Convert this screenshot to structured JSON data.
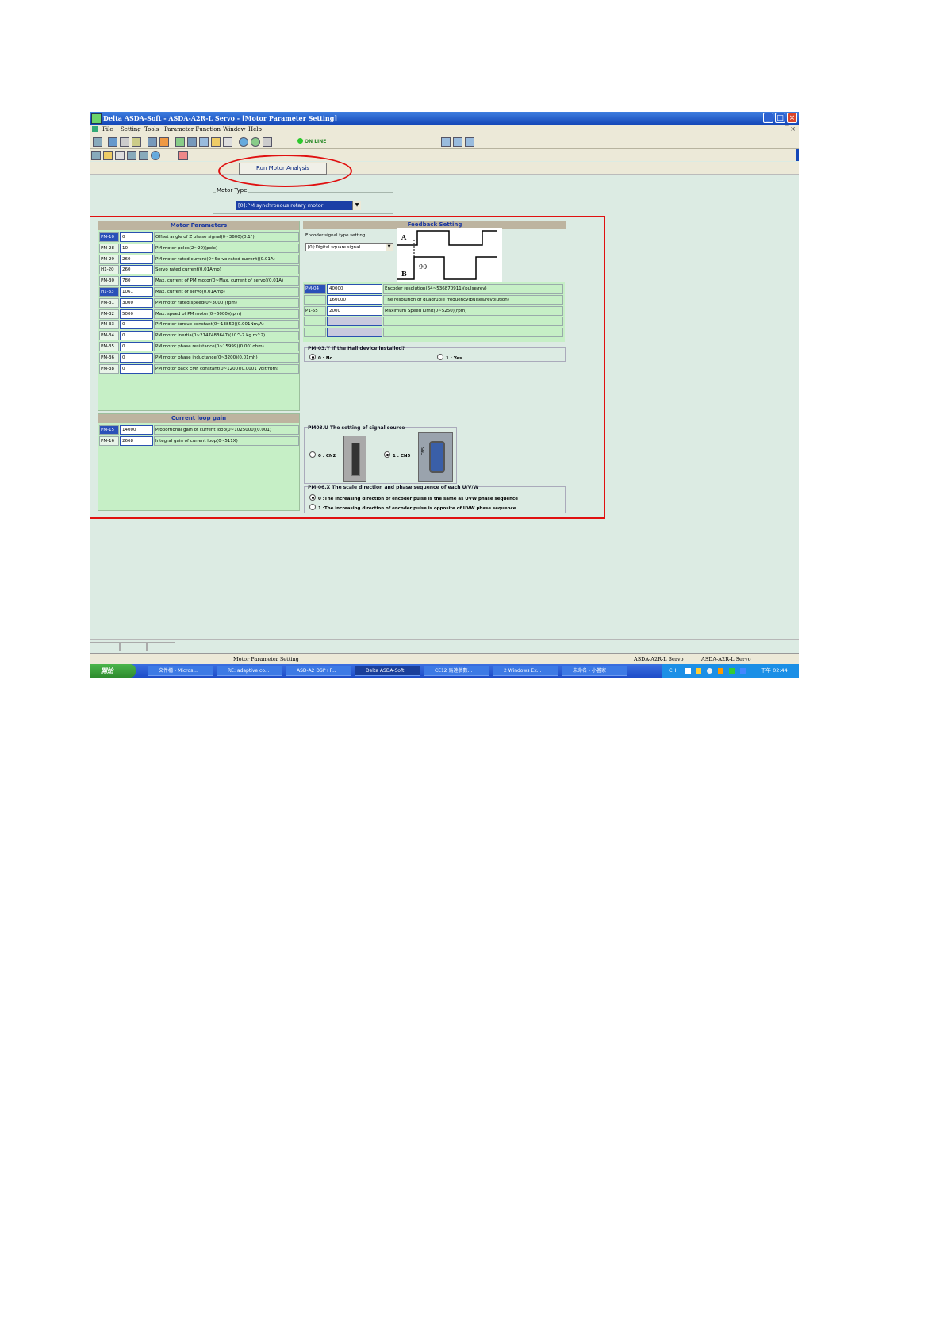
{
  "window": {
    "title": "Delta ASDA-Soft - ASDA-A2R-L Servo - [Motor Parameter Setting]",
    "controls": [
      "_",
      "□",
      "×"
    ]
  },
  "menu": {
    "items": [
      "File",
      "Setting",
      "Tools",
      "Parameter Function",
      "Window",
      "Help"
    ],
    "mdi_controls": "_  ̅ ×"
  },
  "toolbar": {
    "online_label": "ON LINE"
  },
  "actions": {
    "run_motor_analysis": "Run Motor Analysis"
  },
  "motor_type": {
    "label": "Motor Type",
    "selected": "[0]:PM synchronous rotary motor"
  },
  "motor_parameters": {
    "title": "Motor Parameters",
    "rows": [
      {
        "code": "PM-10",
        "value": "0",
        "desc": "Offset angle of Z phase signal(0~3600)(0.1°)"
      },
      {
        "code": "PM-28",
        "value": "10",
        "desc": "PM motor poles(2~20)(pole)"
      },
      {
        "code": "PM-29",
        "value": "260",
        "desc": "PM motor rated current(0~Servo rated current)(0.01A)"
      },
      {
        "code": "H1-20",
        "value": "260",
        "desc": "Servo rated current(0.01Amp)"
      },
      {
        "code": "PM-30",
        "value": "780",
        "desc": "Max. current of PM motor(0~Max. current of servo)(0.01A)"
      },
      {
        "code": "H1-33",
        "value": "1061",
        "desc": "Max. current of servo(0.01Amp)"
      },
      {
        "code": "PM-31",
        "value": "3000",
        "desc": "PM motor rated speed(0~3000)(rpm)"
      },
      {
        "code": "PM-32",
        "value": "5000",
        "desc": "Max. speed of PM motor(0~6000)(rpm)"
      },
      {
        "code": "PM-33",
        "value": "0",
        "desc": "PM motor torque constant(0~13850)(0.001Nm/A)"
      },
      {
        "code": "PM-34",
        "value": "0",
        "desc": "PM motor inertia(0~2147483647)(10^-7 kg.m^2)"
      },
      {
        "code": "PM-35",
        "value": "0",
        "desc": "PM motor phase resistance(0~15999)(0.001ohm)"
      },
      {
        "code": "PM-36",
        "value": "0",
        "desc": "PM motor phase inductance(0~3200)(0.01mh)"
      },
      {
        "code": "PM-38",
        "value": "0",
        "desc": "PM motor back EMF constant(0~1200)(0.0001 Volt/rpm)"
      }
    ]
  },
  "current_loop": {
    "title": "Current loop gain",
    "rows": [
      {
        "code": "PM-15",
        "value": "14000",
        "desc": "Proportional gain of current loop(0~1025000)(0.001)"
      },
      {
        "code": "PM-16",
        "value": "2668",
        "desc": "Integral gain of current loop(0~511X)"
      }
    ]
  },
  "feedback": {
    "title": "Feedback Setting",
    "encoder_label": "Encoder signal type setting",
    "encoder_selected": "[0]:Digital square signal",
    "wave_labels": {
      "a": "A",
      "b": "B",
      "phase": "90"
    },
    "rows": [
      {
        "code": "PM-04",
        "value": "40000",
        "desc": "Encoder resolution(64~536870911)(pulse/rev)"
      },
      {
        "code": "",
        "value": "160000",
        "desc": "The resolution of quadruple frequency(pulses/revolution)"
      },
      {
        "code": "P1-55",
        "value": "2000",
        "desc": "Maximum Speed Limit(0~5250)(rpm)"
      },
      {
        "code": "",
        "value": "",
        "desc": ""
      },
      {
        "code": "",
        "value": "",
        "desc": ""
      }
    ],
    "hall": {
      "title": "PM-03.Y If the Hall device installed?",
      "opt0": "0 : No",
      "opt1": "1 : Yes"
    },
    "signal_source": {
      "title": "PM03.U The setting of signal source",
      "opt0": "0 : CN2",
      "opt1": "1 : CN5",
      "cn5_tag": "CN5"
    },
    "direction": {
      "title": "PM-06.X The scale direction and phase sequence of each U/V/W",
      "opt0": "0 :The increasing direction of encoder pulse is the same as UVW phase sequence",
      "opt1": "1 :The increasing direction of encoder pulse is opposite of UVW phase sequence"
    }
  },
  "statusbar": {
    "left": "Motor Parameter Setting",
    "model1": "ASDA-A2R-L Servo",
    "model2": "ASDA-A2R-L Servo"
  },
  "taskbar": {
    "start": "開始",
    "tasks": [
      "文件檔 - Micros...",
      "RE: adaptive co...",
      "ASD-A2 DSP+F...",
      "Delta ASDA-Soft",
      "CE12 馬達參數...",
      "2 Windows Ex...",
      "未命名 - 小畨家"
    ],
    "lang": "CH",
    "clock": "下午 02:44"
  },
  "colors": {
    "highlight_border": "#e01010",
    "panel_green": "#c6efc6",
    "header_blue": "#1a37a0"
  }
}
